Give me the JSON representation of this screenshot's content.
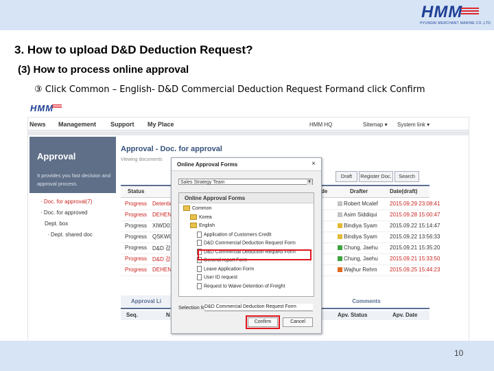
{
  "brand": {
    "logo": "HMM",
    "logo_sub": "HYUNDAI MERCHANT MARINE CO.,LTD."
  },
  "slide": {
    "title": "3. How to upload D&D Deduction Request?",
    "subtitle": "(3) How to process online approval",
    "step": "③ Click Common – English- D&D Commercial Deduction Request Formand click Confirm",
    "page_number": "10"
  },
  "portal": {
    "nav": [
      "News",
      "Management",
      "Support",
      "My Place"
    ],
    "nav_right": [
      "HMM HQ",
      "Sitemap ▾",
      "System link ▾"
    ],
    "sidebar": {
      "title": "Approval",
      "desc": "It provides you fast decision and approval process.",
      "items": [
        "· Doc. for approval(7)",
        "· Doc. for approved",
        "Dept. box",
        "· Dept. shared doc"
      ]
    },
    "content": {
      "title": "Approval - Doc. for approval",
      "subtitle": "Viewing documents",
      "buttons": [
        "Draft",
        "Register Doc.",
        "Search"
      ],
      "columns": [
        "Status",
        "de",
        "Drafter",
        "Date(draft)"
      ],
      "rows": [
        {
          "status": "Progress",
          "doc": "Detention",
          "drafter": "Robert Mcalef",
          "date": "2015.09.29 23:08:41",
          "red": true,
          "avatar": "#c4c4c4"
        },
        {
          "status": "Progress",
          "doc": "DEHENG",
          "drafter": "Asim Siddiqui",
          "date": "2015.09.28 15:00:47",
          "red": true,
          "avatar": "#c4c4c4"
        },
        {
          "status": "Progress",
          "doc": "XIWD01",
          "drafter": "Bindiya Syam",
          "date": "2015.09.22 15:14:47",
          "red": false,
          "avatar": "#e1b935"
        },
        {
          "status": "Progress",
          "doc": "QSKW01",
          "drafter": "Bindiya Syam",
          "date": "2015.09.22 13:56:33",
          "red": false,
          "avatar": "#e1b935"
        },
        {
          "status": "Progress",
          "doc": "D&D 감면",
          "drafter": "Chung, Jaehu",
          "date": "2015.09.21 15:35:20",
          "red": false,
          "avatar": "#3fa33f"
        },
        {
          "status": "Progress",
          "doc": "D&D 감면",
          "drafter": "Chung, Jaehu",
          "date": "2015.09.21 15:33:50",
          "red": true,
          "avatar": "#3fa33f"
        },
        {
          "status": "Progress",
          "doc": "DEHENG",
          "drafter": "Wajhur Rehm",
          "date": "2015.09.25 15:44:23",
          "red": true,
          "avatar": "#e06b1e"
        }
      ],
      "tabs": [
        "Approval Li",
        "Comments"
      ],
      "subhead": [
        "Seq.",
        "N",
        "Apv. Status",
        "Apv. Date"
      ]
    }
  },
  "dialog": {
    "title": "Online Approval Forms",
    "close": "×",
    "dropdown": "Sales Strategy Team",
    "tree_header": "Online Approval Forms",
    "tree": [
      {
        "label": "Common",
        "kind": "folder",
        "indent": 0
      },
      {
        "label": "Korea",
        "kind": "folder",
        "indent": 1
      },
      {
        "label": "English",
        "kind": "folder",
        "indent": 1
      },
      {
        "label": "Application of Customers Credit",
        "kind": "doc",
        "indent": 2
      },
      {
        "label": "D&D Commercial Deduction Request Form",
        "kind": "doc",
        "indent": 2
      },
      {
        "label": "D&D Commercial Deduction Request Form",
        "kind": "doc",
        "indent": 2
      },
      {
        "label": "General report Form",
        "kind": "doc",
        "indent": 2
      },
      {
        "label": "Leave Application Form",
        "kind": "doc",
        "indent": 2
      },
      {
        "label": "User ID request",
        "kind": "doc",
        "indent": 2
      },
      {
        "label": "Request to Waive Detention of Freight",
        "kind": "doc",
        "indent": 2
      }
    ],
    "selection_label": "Selection form",
    "selection_value": "D&D Commercial Deduction Request Form",
    "confirm": "Confirm",
    "cancel": "Cancel"
  },
  "colors": {
    "brand_blue": "#1f3f95",
    "highlight_red": "#e0141c",
    "band": "#d6e4f5",
    "sidebar": "#5f6f88"
  }
}
